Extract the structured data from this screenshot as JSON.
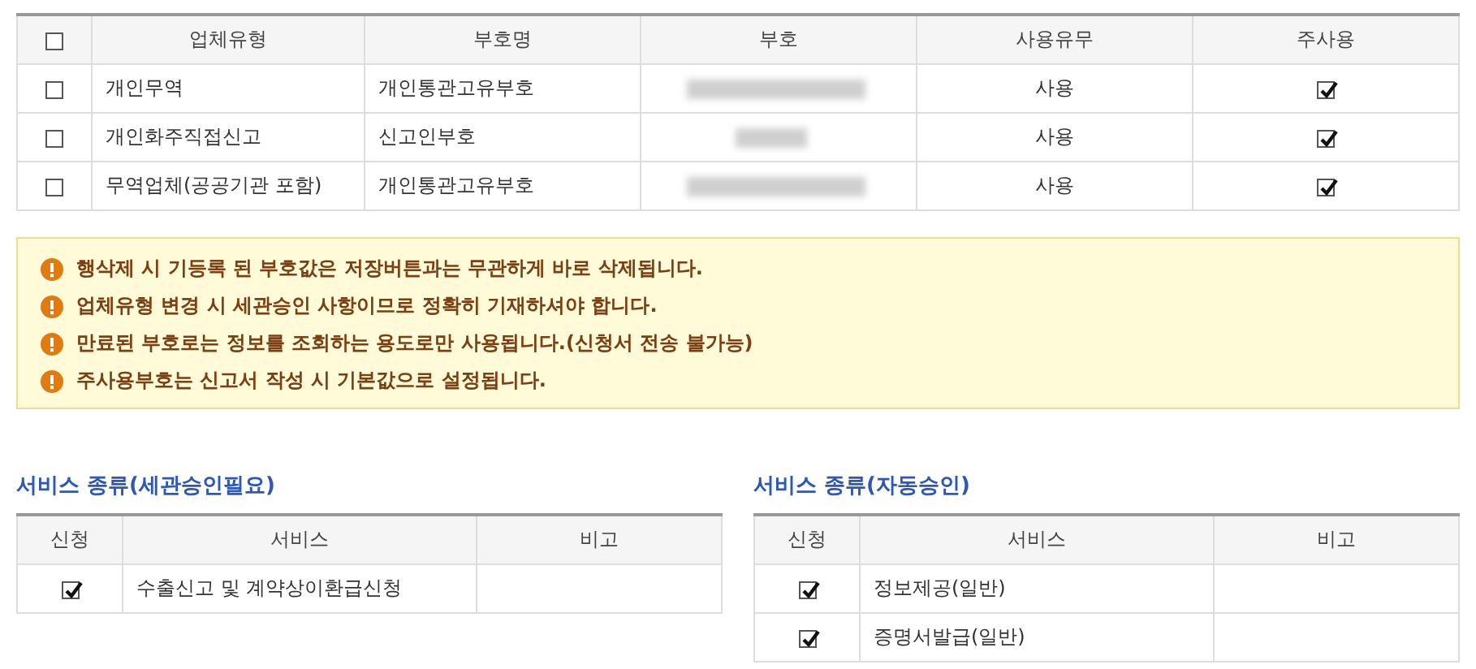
{
  "main_table": {
    "select_all": {
      "checked": false
    },
    "columns": [
      "업체유형",
      "부호명",
      "부호",
      "사용유무",
      "주사용"
    ],
    "rows": [
      {
        "checked": false,
        "type": "개인무역",
        "code_name": "개인통관고유부호",
        "code": {
          "kind": "blurred_long"
        },
        "usage": "사용",
        "primary": true
      },
      {
        "checked": false,
        "type": "개인화주직접신고",
        "code_name": "신고인부호",
        "code": {
          "kind": "blurred_short"
        },
        "usage": "사용",
        "primary": true
      },
      {
        "checked": false,
        "type": "무역업체(공공기관 포함)",
        "code_name": "개인통관고유부호",
        "code": {
          "kind": "blurred_long"
        },
        "usage": "사용",
        "primary": true
      }
    ]
  },
  "notices": [
    "행삭제 시 기등록 된 부호값은 저장버튼과는 무관하게 바로 삭제됩니다.",
    "업체유형 변경 시 세관승인 사항이므로 정확히 기재하셔야 합니다.",
    "만료된 부호로는 정보를 조회하는 용도로만 사용됩니다.(신청서 전송 불가능)",
    "주사용부호는 신고서 작성 시 기본값으로 설정됩니다."
  ],
  "service_sections": [
    {
      "title": "서비스 종류(세관승인필요)",
      "columns": [
        "신청",
        "서비스",
        "비고"
      ],
      "rows": [
        {
          "checked": true,
          "service": "수출신고 및 계약상이환급신청"
        }
      ]
    },
    {
      "title": "서비스 종류(자동승인)",
      "columns": [
        "신청",
        "서비스",
        "비고"
      ],
      "rows": [
        {
          "checked": true,
          "service": "정보제공(일반)"
        },
        {
          "checked": true,
          "service": "증명서발급(일반)"
        }
      ]
    }
  ]
}
